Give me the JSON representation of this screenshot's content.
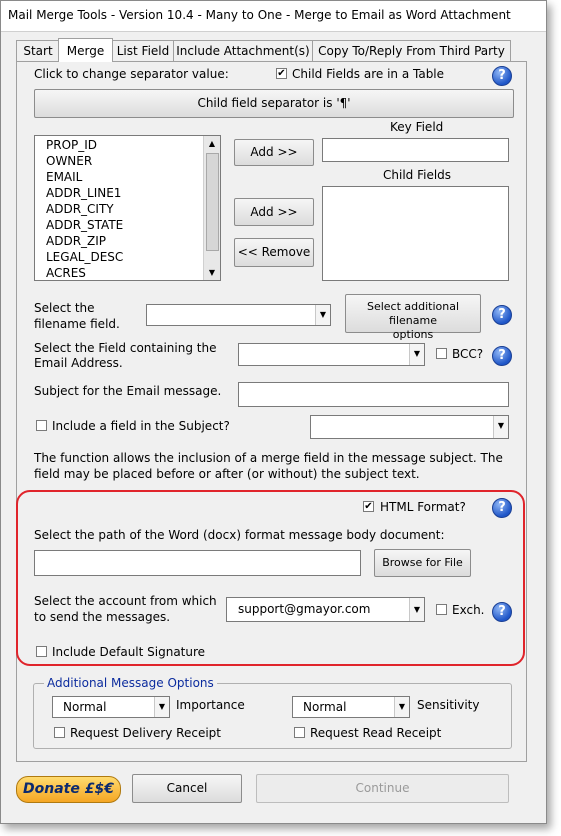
{
  "window": {
    "title": "Mail Merge Tools - Version 10.4 - Many to One - Merge to Email as Word Attachment"
  },
  "tabs": [
    {
      "label": "Start"
    },
    {
      "label": "Merge"
    },
    {
      "label": "List Field"
    },
    {
      "label": "Include Attachment(s)"
    },
    {
      "label": "Copy To/Reply From Third Party"
    }
  ],
  "separator": {
    "click_label": "Click to change separator value:",
    "child_in_table_label": "Child Fields are in a Table",
    "child_in_table_checked": true,
    "button_label": "Child field separator is '¶'"
  },
  "fields": {
    "list": [
      "PROP_ID",
      "OWNER",
      "EMAIL",
      "ADDR_LINE1",
      "ADDR_CITY",
      "ADDR_STATE",
      "ADDR_ZIP",
      "LEGAL_DESC",
      "ACRES"
    ],
    "key_field_label": "Key Field",
    "child_fields_label": "Child Fields",
    "add_key_label": "Add >>",
    "add_child_label": "Add >>",
    "remove_label": "<< Remove"
  },
  "filename": {
    "label_line1": "Select the",
    "label_line2": "filename field.",
    "options_btn_line1": "Select additional filename",
    "options_btn_line2": "options"
  },
  "email_field": {
    "label_line1": "Select the Field containing the",
    "label_line2": "Email Address.",
    "bcc_label": "BCC?"
  },
  "subject": {
    "label": "Subject for the Email message.",
    "include_label": "Include a field in the Subject?",
    "note_line1": "The function allows the inclusion of a merge field in the message subject. The",
    "note_line2": "field may be placed before or after (or without) the subject text."
  },
  "body": {
    "html_format_label": "HTML Format?",
    "html_format_checked": true,
    "path_label": "Select the path of the Word (docx) format message body document:",
    "browse_label": "Browse for File",
    "account_label_line1": "Select the account from which",
    "account_label_line2": "to send the messages.",
    "account_value": "support@gmayor.com",
    "exch_label": "Exch.",
    "signature_label": "Include Default Signature"
  },
  "options": {
    "title": "Additional Message Options",
    "importance_value": "Normal",
    "importance_label": "Importance",
    "sensitivity_value": "Normal",
    "sensitivity_label": "Sensitivity",
    "delivery_receipt_label": "Request Delivery Receipt",
    "read_receipt_label": "Request Read Receipt"
  },
  "footer": {
    "donate_label": "Donate £$€",
    "cancel_label": "Cancel",
    "continue_label": "Continue"
  },
  "icons": {
    "help": "help-icon",
    "check": "✔"
  },
  "colors": {
    "highlight_box": "#e0242b",
    "group_title": "#0c2c9e",
    "help_icon": "#1f56c8"
  }
}
